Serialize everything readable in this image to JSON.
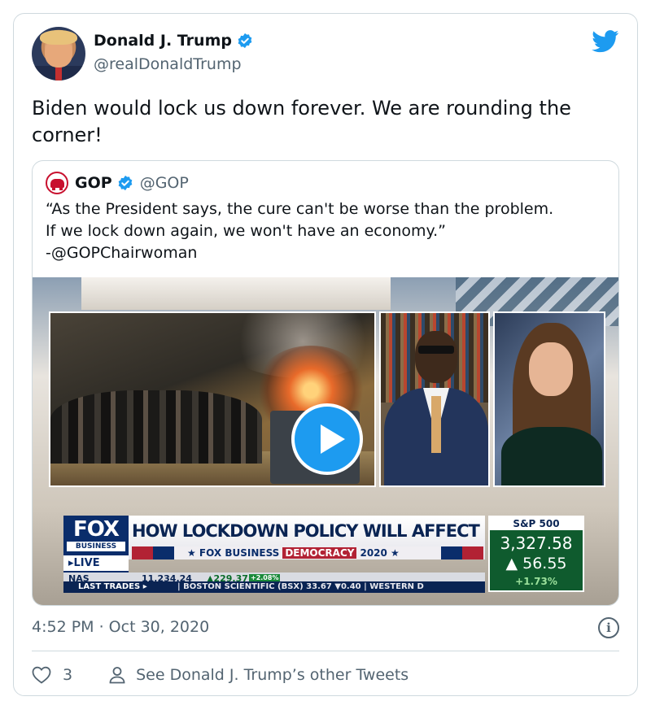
{
  "author": {
    "name": "Donald J. Trump",
    "handle": "@realDonaldTrump"
  },
  "tweet": {
    "text": "Biden would lock us down forever. We are rounding the corner!",
    "timestamp": "4:52 PM · Oct 30, 2020",
    "like_count": "3",
    "other_tweets_label": "See Donald J. Trump’s other Tweets"
  },
  "quoted": {
    "name": "GOP",
    "handle": "@GOP",
    "text_line1": "“As the President says, the cure can't be worse than the problem.",
    "text_line2": "If we lock down again, we won't have an economy.”",
    "text_line3": "-@GOPChairwoman"
  },
  "video": {
    "network_logo": "FOX",
    "network_sub": "BUSINESS",
    "live_label": "▸LIVE",
    "headline": "HOW LOCKDOWN POLICY WILL AFFECT ELECTION",
    "banner_brand": "★ FOX BUSINESS",
    "banner_topic": "DEMOCRACY",
    "banner_year": "2020 ★",
    "nas_label": "NAS",
    "nas_value": "11,234.24",
    "nas_change": "▲229.37",
    "nas_pct": "+2.08%",
    "last_trades_label": "LAST TRADES ▸",
    "last_trades_text": "| BOSTON SCIENTIFIC (BSX) 33.67 ▼0.40 | WESTERN D",
    "sp_title": "S&P 500",
    "sp_value": "3,327.58",
    "sp_change": "▲ 56.55",
    "sp_pct": "+1.73%"
  },
  "colors": {
    "twitter_blue": "#1d9bf0",
    "gop_red": "#c8102e",
    "fox_navy": "#0a2d6b"
  }
}
